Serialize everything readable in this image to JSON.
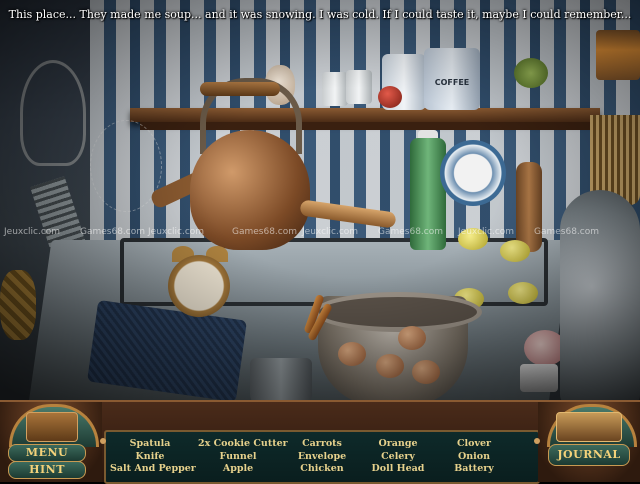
{
  "narration": "This place... They made me soup...  and it was snowing.  I was cold.  If I could taste it, maybe I could remember...",
  "watermarks": [
    "Jeuxclic.com",
    "Games68.com",
    "Jeuxclic.com",
    "Games68.com",
    "Jeuxclic.com",
    "Games68.com",
    "Jeuxclic.com",
    "Games68.com"
  ],
  "scene_labels": {
    "coffee_can": "COFFEE"
  },
  "hud": {
    "menu_label": "MENU",
    "hint_label": "HINT",
    "journal_label": "JOURNAL"
  },
  "item_columns": [
    [
      "Spatula",
      "Knife",
      "Salt And Pepper"
    ],
    [
      "2x Cookie Cutter",
      "Funnel",
      "Apple"
    ],
    [
      "Carrots",
      "Envelope",
      "Chicken"
    ],
    [
      "Orange",
      "Celery",
      "Doll Head"
    ],
    [
      "Clover",
      "Onion",
      "Battery"
    ]
  ],
  "colors": {
    "hud_wood": "#4a2b1a",
    "item_text": "#e6d18c",
    "button_face": "#3c6a5c",
    "button_text": "#f3d27a"
  }
}
